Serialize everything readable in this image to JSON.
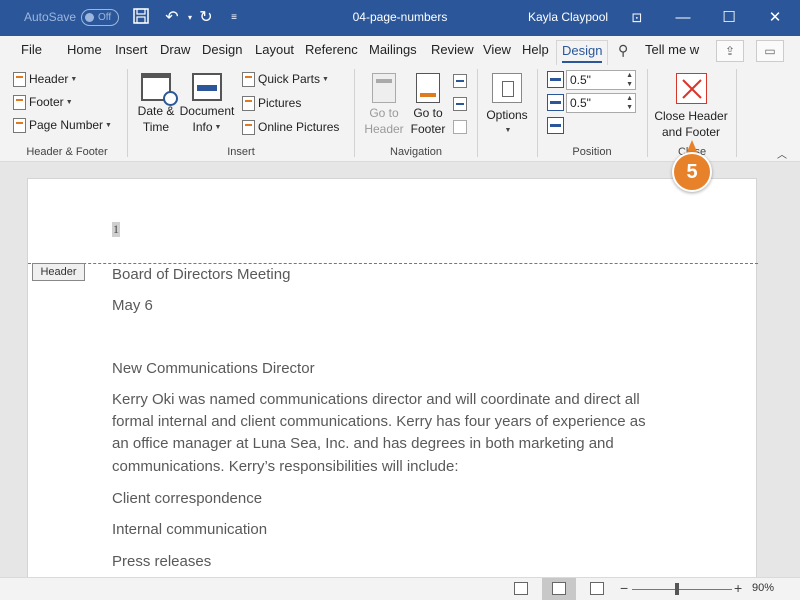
{
  "titlebar": {
    "autosave_label": "AutoSave",
    "autosave_state": "Off",
    "doc_title": "04-page-numbers",
    "user": "Kayla Claypool",
    "tell_me_placeholder": "Tell me w"
  },
  "tabs": [
    {
      "label": "File"
    },
    {
      "label": "Home"
    },
    {
      "label": "Insert"
    },
    {
      "label": "Draw"
    },
    {
      "label": "Design"
    },
    {
      "label": "Layout"
    },
    {
      "label": "Referenc"
    },
    {
      "label": "Mailings"
    },
    {
      "label": "Review"
    },
    {
      "label": "View"
    },
    {
      "label": "Help"
    },
    {
      "label": "Design",
      "active": true
    }
  ],
  "ribbon": {
    "header_footer": {
      "header": "Header",
      "footer": "Footer",
      "page_number": "Page Number",
      "group_label": "Header & Footer"
    },
    "insert": {
      "date_time_line1": "Date &",
      "date_time_line2": "Time",
      "doc_info_line1": "Document",
      "doc_info_line2": "Info",
      "quick_parts": "Quick Parts",
      "pictures": "Pictures",
      "online_pictures": "Online Pictures",
      "group_label": "Insert"
    },
    "navigation": {
      "goto_header_line1": "Go to",
      "goto_header_line2": "Header",
      "goto_footer_line1": "Go to",
      "goto_footer_line2": "Footer",
      "group_label": "Navigation"
    },
    "options": {
      "label": "Options"
    },
    "position": {
      "header_from_top": "0.5\"",
      "footer_from_bottom": "0.5\"",
      "group_label": "Position"
    },
    "close": {
      "line1": "Close Header",
      "line2": "and Footer",
      "group_label": "Close"
    }
  },
  "document": {
    "page_number": "1",
    "header_tag": "Header",
    "title": "Board of Directors Meeting",
    "date": "May 6",
    "heading": "New Communications Director",
    "paragraph_lines": [
      "Kerry Oki was named communications director and will coordinate and direct all",
      "formal internal and client communications. Kerry has four years of experience as",
      "an office manager at Luna Sea, Inc. and has degrees in both marketing and",
      "communications. Kerry’s responsibilities will include:"
    ],
    "items": [
      "Client correspondence",
      "Internal communication",
      "Press releases"
    ]
  },
  "callout": {
    "step": "5",
    "color": "#e8822a"
  },
  "statusbar": {
    "zoom_level": "90%",
    "zoom_minus": "−",
    "zoom_plus": "+"
  },
  "colors": {
    "accent": "#2b579a",
    "close_icon": "#d9362b"
  }
}
